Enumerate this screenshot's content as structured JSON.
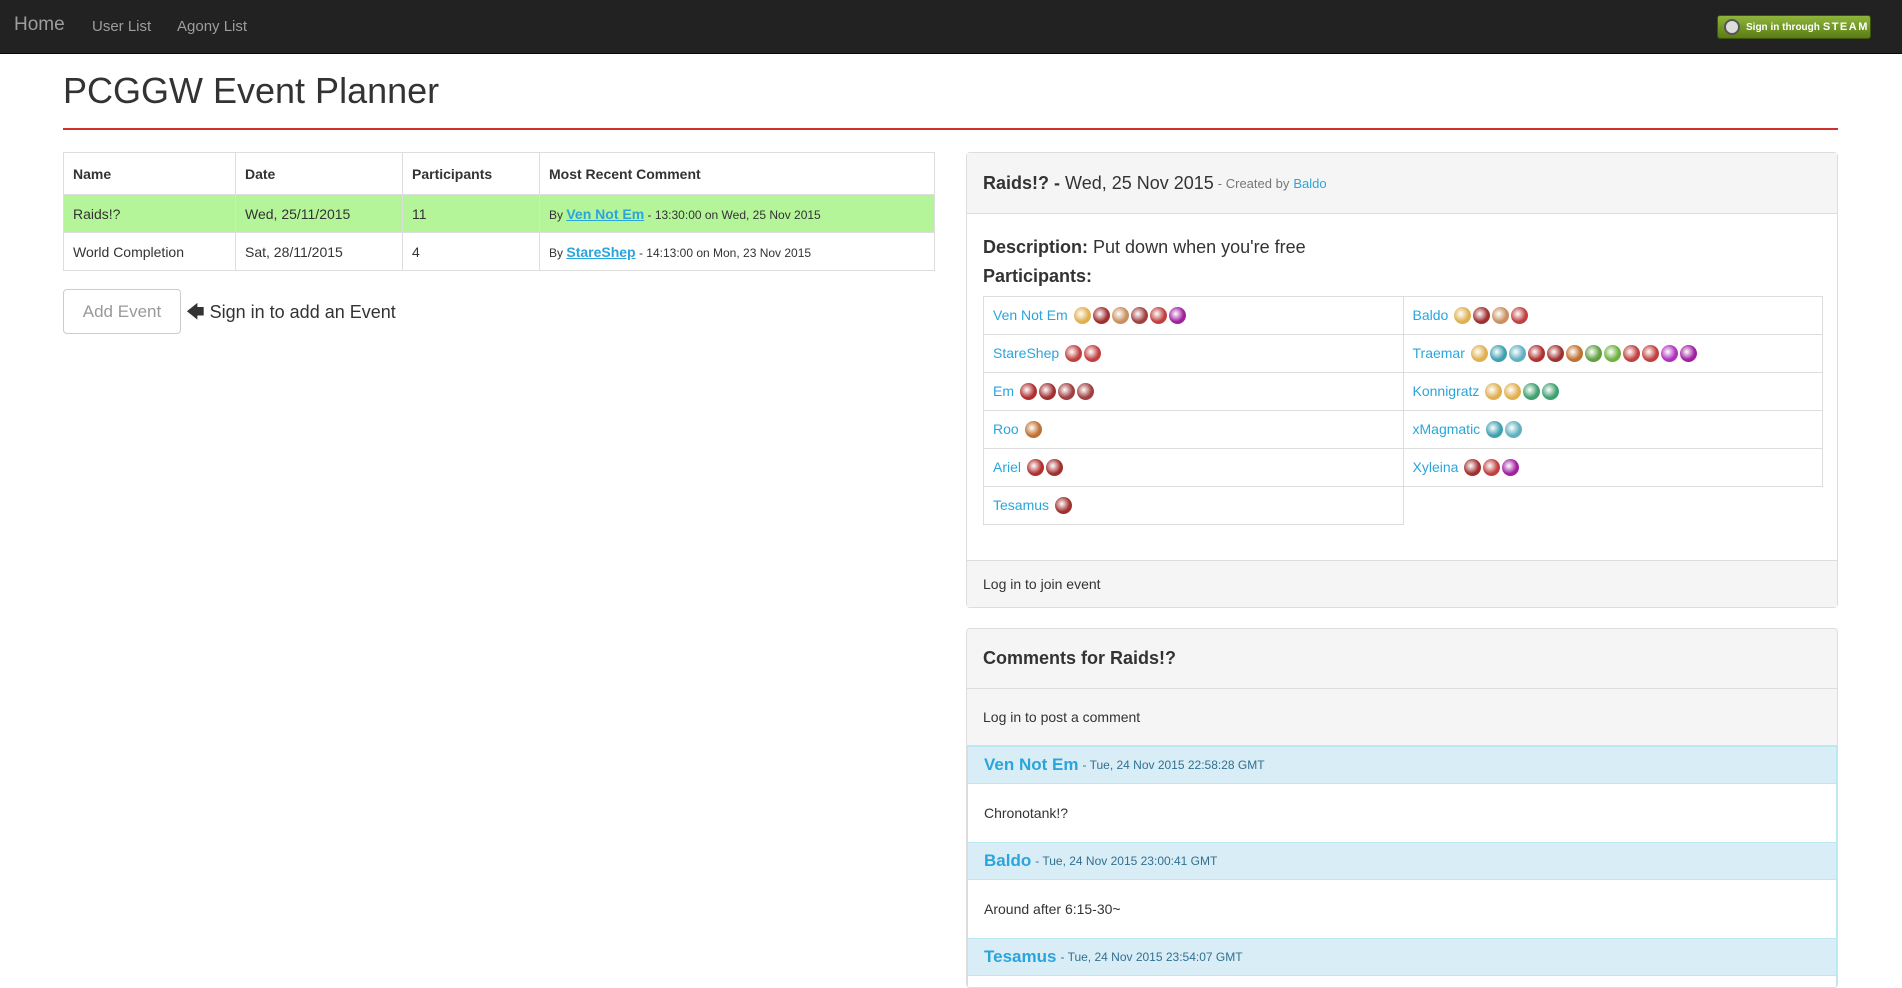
{
  "nav": {
    "brand": "Home",
    "links": [
      "User List",
      "Agony List"
    ],
    "steam_prefix": "Sign in through",
    "steam_word": "STEAM"
  },
  "page": {
    "title": "PCGGW Event Planner"
  },
  "events_table": {
    "headers": [
      "Name",
      "Date",
      "Participants",
      "Most Recent Comment"
    ],
    "rows": [
      {
        "name": "Raids!?",
        "date": "Wed, 25/11/2015",
        "participants": "11",
        "by": "By",
        "author": "Ven Not Em",
        "stamp": "- 13:30:00 on Wed, 25 Nov 2015"
      },
      {
        "name": "World Completion",
        "date": "Sat, 28/11/2015",
        "participants": "4",
        "by": "By",
        "author": "StareShep",
        "stamp": "- 14:13:00 on Mon, 23 Nov 2015"
      }
    ]
  },
  "add_event": {
    "label": "Add Event",
    "hint": "Sign in to add an Event"
  },
  "event_panel": {
    "name": "Raids!? -",
    "date": "Wed, 25 Nov 2015",
    "created_by_prefix": "- Created by",
    "creator": "Baldo",
    "description_label": "Description:",
    "description": "Put down when you're free",
    "participants_label": "Participants:",
    "participants": [
      {
        "name": "Ven Not Em",
        "badges": [
          "#e0b050",
          "#a03030",
          "#c89060",
          "#a04040",
          "#c04040",
          "#a020a0"
        ]
      },
      {
        "name": "Baldo",
        "badges": [
          "#e0b050",
          "#a03030",
          "#c89060",
          "#c04040"
        ]
      },
      {
        "name": "StareShep",
        "badges": [
          "#c04040",
          "#c04040"
        ]
      },
      {
        "name": "Traemar",
        "badges": [
          "#e0b050",
          "#40a0b0",
          "#60b0c0",
          "#b03030",
          "#a03030",
          "#c07030",
          "#60a040",
          "#70b040",
          "#c04040",
          "#c04040",
          "#b030c0",
          "#a020a0"
        ]
      },
      {
        "name": "Em",
        "badges": [
          "#b03030",
          "#a03030",
          "#a04040",
          "#a04040"
        ]
      },
      {
        "name": "Konnigratz",
        "badges": [
          "#e0b050",
          "#e0b050",
          "#40a070",
          "#40a070"
        ]
      },
      {
        "name": "Roo",
        "badges": [
          "#c07030"
        ]
      },
      {
        "name": "xMagmatic",
        "badges": [
          "#40a0b0",
          "#60b0c0"
        ]
      },
      {
        "name": "Ariel",
        "badges": [
          "#b03030",
          "#a03030"
        ]
      },
      {
        "name": "Xyleina",
        "badges": [
          "#a03030",
          "#c04040",
          "#a020a0"
        ]
      },
      {
        "name": "Tesamus",
        "badges": [
          "#a03030"
        ]
      }
    ],
    "footer": "Log in to join event"
  },
  "comments_panel": {
    "title": "Comments for Raids!?",
    "login_prompt": "Log in to post a comment",
    "comments": [
      {
        "author": "Ven Not Em",
        "stamp": "- Tue, 24 Nov 2015 22:58:28 GMT",
        "text": "Chronotank!?"
      },
      {
        "author": "Baldo",
        "stamp": "- Tue, 24 Nov 2015 23:00:41 GMT",
        "text": "Around after 6:15-30~"
      },
      {
        "author": "Tesamus",
        "stamp": "- Tue, 24 Nov 2015 23:54:07 GMT",
        "text": ""
      }
    ]
  }
}
